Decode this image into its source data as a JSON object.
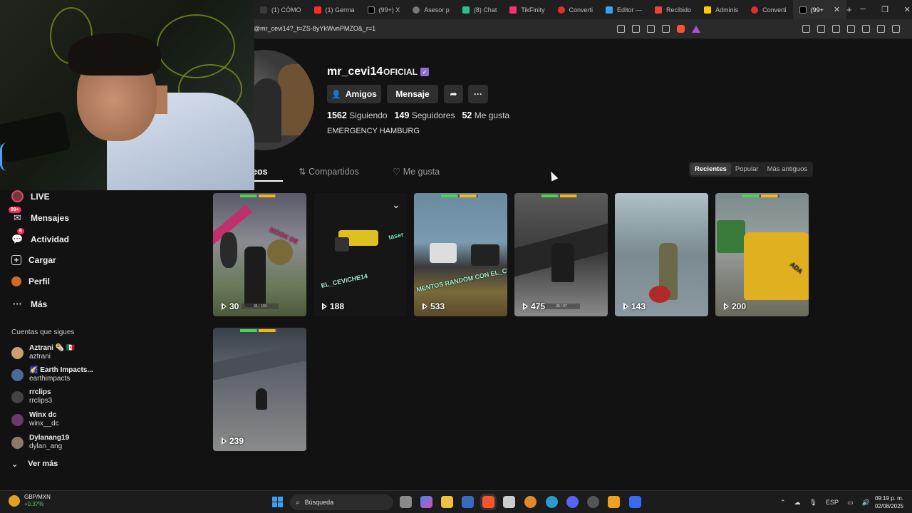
{
  "browser": {
    "tabs": [
      {
        "label": "(1) CÓMO",
        "color": "#e0e0e0"
      },
      {
        "label": "(1) Germa",
        "color": "#ff2b2b"
      },
      {
        "label": "(99+) X",
        "color": "#ffffff"
      },
      {
        "label": "Asesor p",
        "color": "#cfcfcf"
      },
      {
        "label": "(8) Chat",
        "color": "#2fbf8a"
      },
      {
        "label": "TikFinity",
        "color": "#ff2d6f"
      },
      {
        "label": "Converti",
        "color": "#e0302a"
      },
      {
        "label": "Editor —",
        "color": "#3aa0f2"
      },
      {
        "label": "Recibido",
        "color": "#ea4335"
      },
      {
        "label": "Adminis",
        "color": "#ffcc00"
      },
      {
        "label": "Converti",
        "color": "#e0302a"
      },
      {
        "label": "(99+",
        "color": "#ffffff"
      }
    ],
    "url": "@mr_cevi14?_t=ZS-8yYkWvnPMZO&_r=1"
  },
  "profile": {
    "username": "mr_cevi14",
    "badge": "OFICIAL",
    "buttons": {
      "friends": "Amigos",
      "message": "Mensaje"
    },
    "stats": [
      {
        "value": "1562",
        "label": "Siguiendo"
      },
      {
        "value": "149",
        "label": "Seguidores"
      },
      {
        "value": "52",
        "label": "Me gusta"
      }
    ],
    "bio": "EMERGENCY HAMBURG"
  },
  "tabs": {
    "videos": "eos",
    "shared": "Compartidos",
    "liked": "Me gusta"
  },
  "sort": {
    "recent": "Recientes",
    "popular": "Popular",
    "oldest": "Más antiguos"
  },
  "sidebar": {
    "items": [
      {
        "label": "LIVE"
      },
      {
        "label": "Mensajes",
        "badge": "99+"
      },
      {
        "label": "Actividad",
        "badge": "6"
      },
      {
        "label": "Cargar"
      },
      {
        "label": "Perfil"
      },
      {
        "label": "Más"
      }
    ],
    "following_title": "Cuentas que sigues",
    "following": [
      {
        "name": "Aztrani 🌯 🇲🇽",
        "handle": "aztrani",
        "color": "#c8a070"
      },
      {
        "name": "🌠 Earth Impacts...",
        "handle": "earthimpacts",
        "color": "#4a6a9a"
      },
      {
        "name": "rrclips",
        "handle": "rrclips3",
        "color": "#444444"
      },
      {
        "name": "Winx dc",
        "handle": "winx__dc",
        "color": "#6a3a6a"
      },
      {
        "name": "Dylanang19",
        "handle": "dylan_ang",
        "color": "#8a7a6a"
      }
    ],
    "see_more": "Ver más"
  },
  "videos": [
    {
      "views": "30",
      "ammo": "35 / 105",
      "caption": "MOOK DE"
    },
    {
      "views": "188",
      "caption": "EL_CEVICHE14",
      "caption2": "taser"
    },
    {
      "views": "533",
      "caption": "MENTOS RANDOM CON EL_CEVIC"
    },
    {
      "views": "475",
      "ammo": "35 / 97"
    },
    {
      "views": "143"
    },
    {
      "views": "200",
      "caption": "ADA"
    },
    {
      "views": "239"
    }
  ],
  "taskbar": {
    "ticker": "GBP/MXN",
    "change": "+0.37%",
    "search": "Búsqueda",
    "lang": "ESP",
    "time": "09:19 p. m.",
    "date": "02/08/2025"
  },
  "icons": [
    "search-icon",
    "play-icon",
    "share-icon",
    "more-icon",
    "user-icon",
    "heart-icon",
    "repost-icon",
    "chevron-down-icon",
    "windows-icon"
  ]
}
